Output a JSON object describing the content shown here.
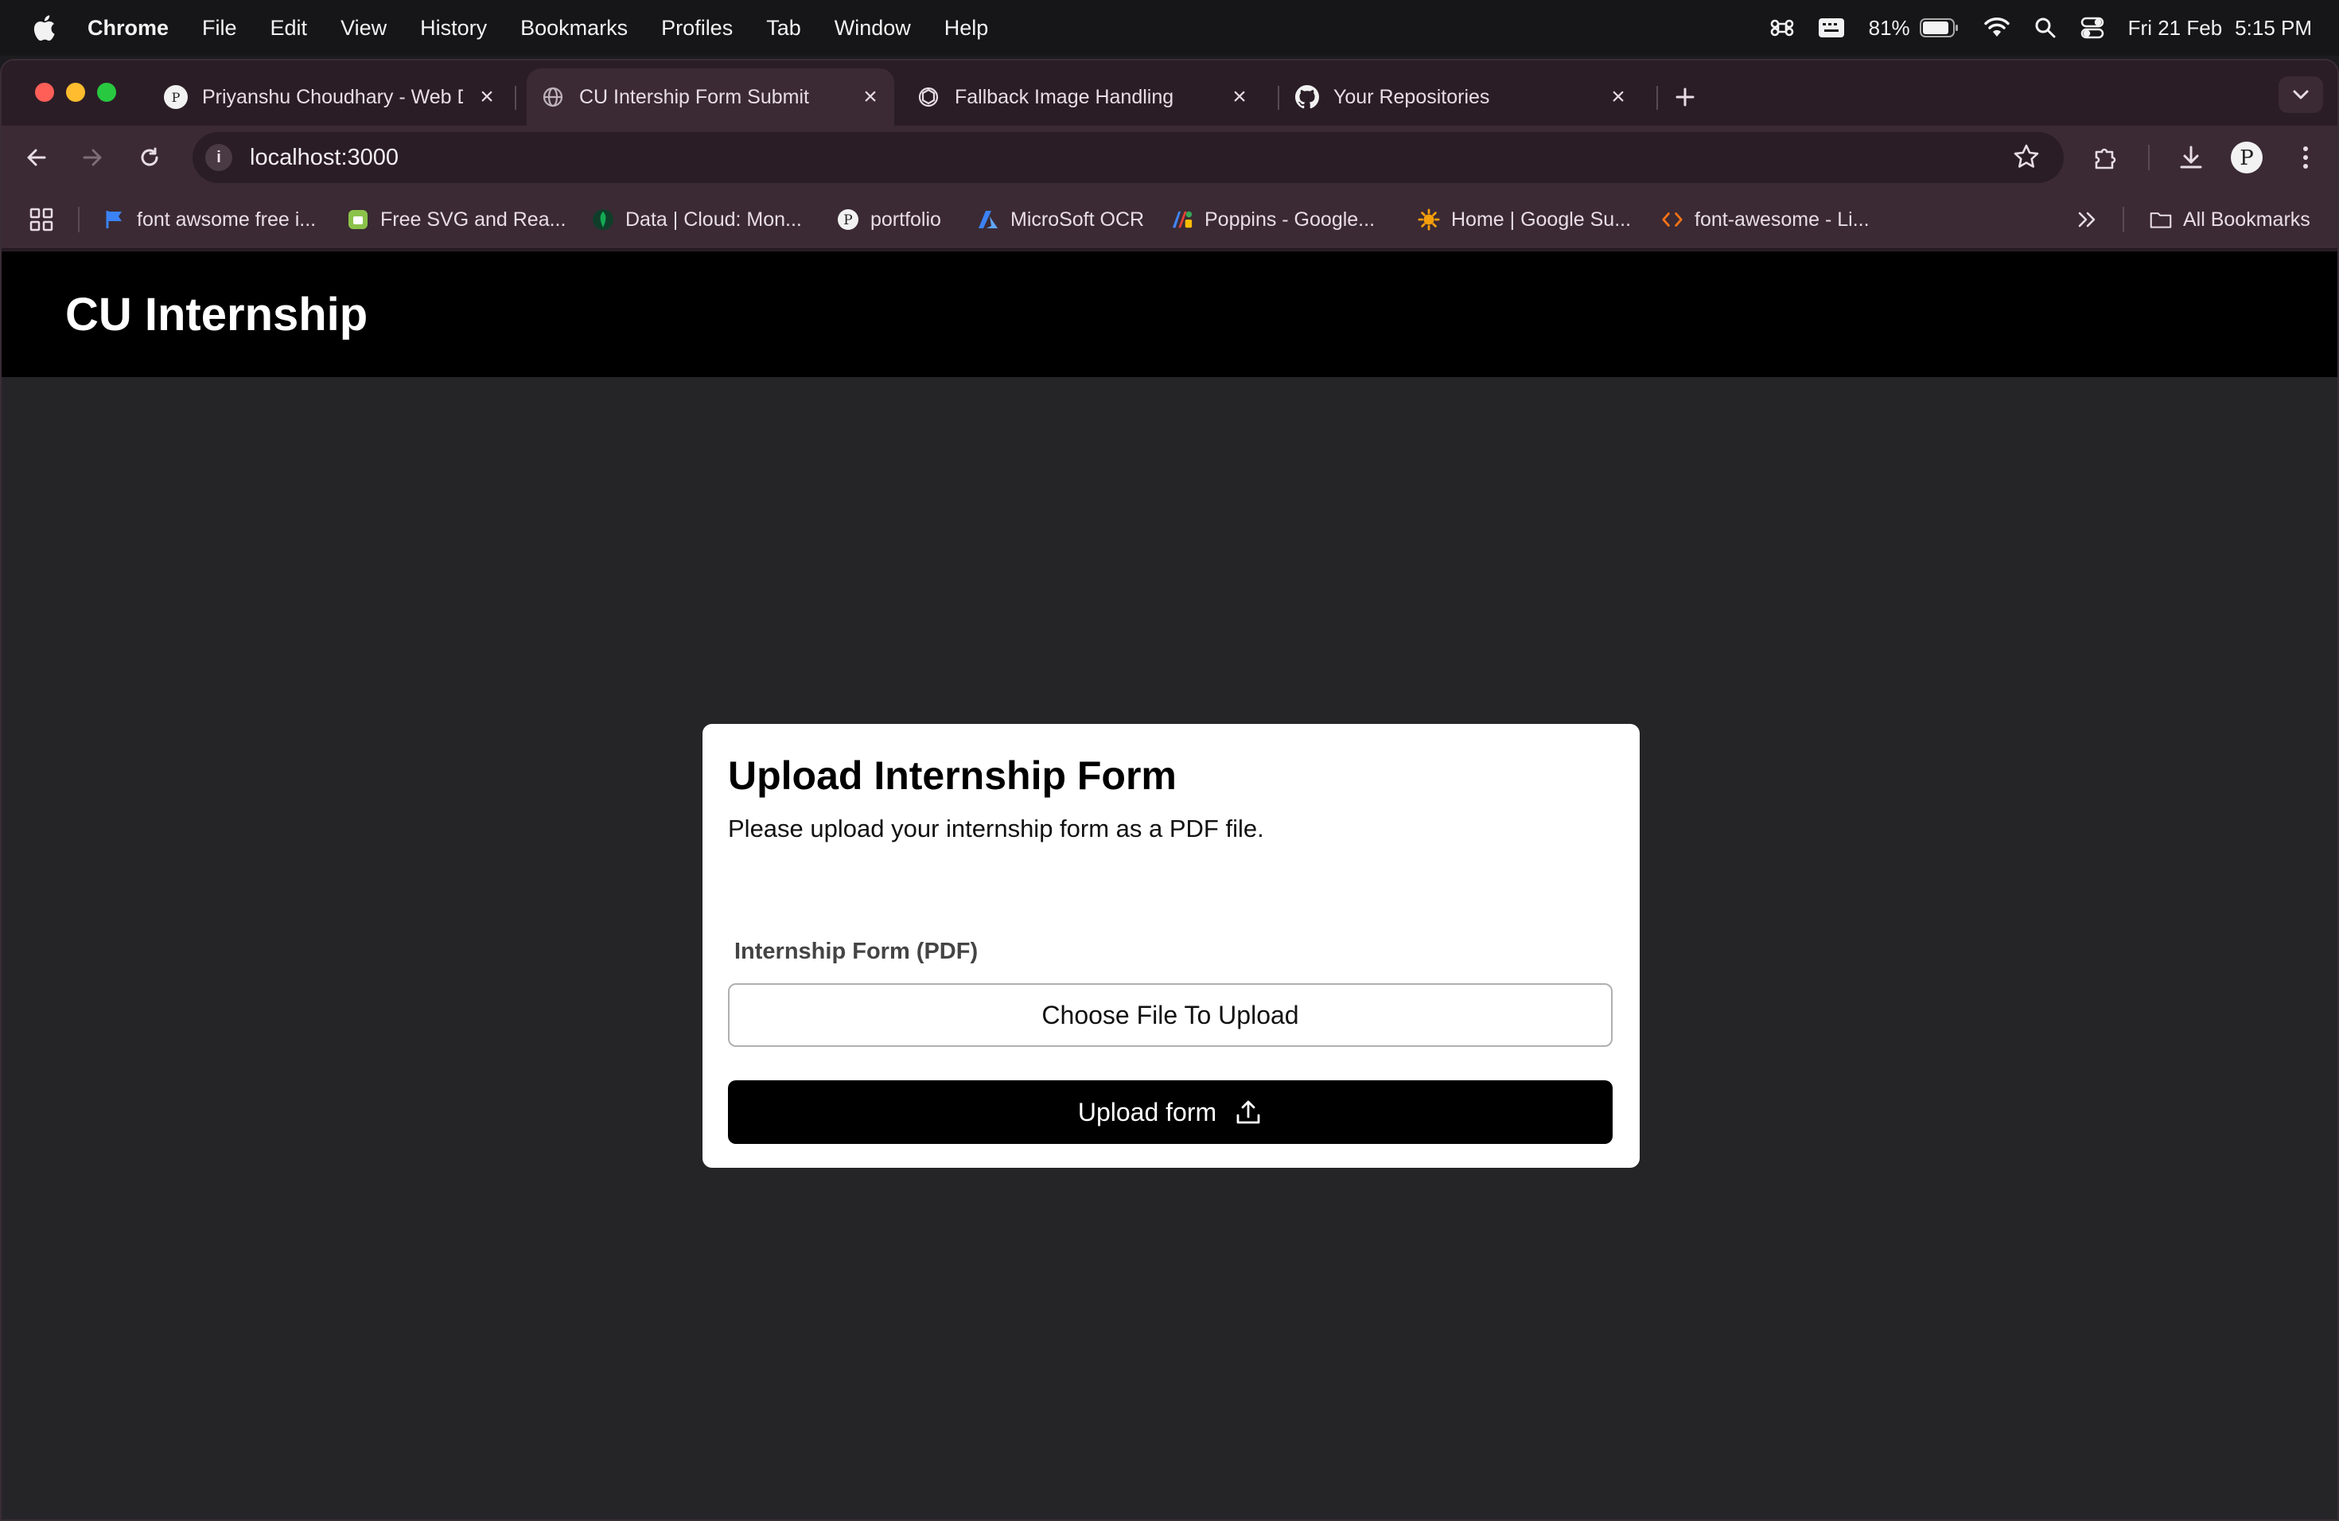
{
  "menubar": {
    "app_name": "Chrome",
    "items": [
      "File",
      "Edit",
      "View",
      "History",
      "Bookmarks",
      "Profiles",
      "Tab",
      "Window",
      "Help"
    ],
    "battery": "81%",
    "date": "Fri 21 Feb",
    "time": "5:15 PM"
  },
  "tabs": [
    {
      "title": "Priyanshu Choudhary - Web D",
      "icon": "profile-favicon"
    },
    {
      "title": "CU Intership Form Submit",
      "icon": "globe-favicon",
      "active": true
    },
    {
      "title": "Fallback Image Handling",
      "icon": "openai-favicon"
    },
    {
      "title": "Your Repositories",
      "icon": "github-favicon"
    }
  ],
  "omnibox": {
    "url": "localhost:3000"
  },
  "bookmarks": {
    "items": [
      {
        "label": "font awsome free i...",
        "icon": "flag-icon",
        "color": "#3b82f6"
      },
      {
        "label": "Free SVG and Rea...",
        "icon": "svgrepo-icon",
        "color": "#8bc34a"
      },
      {
        "label": "Data | Cloud: Mon...",
        "icon": "mongodb-leaf-icon",
        "color": "#13aa52"
      },
      {
        "label": "portfolio",
        "icon": "profile-favicon",
        "color": "#ffffff"
      },
      {
        "label": "MicroSoft OCR",
        "icon": "azure-icon",
        "color": "#3b82f6"
      },
      {
        "label": "Poppins - Google...",
        "icon": "google-fonts-icon",
        "color": "#ea4335"
      },
      {
        "label": "Home | Google Su...",
        "icon": "google-sun-icon",
        "color": "#f59e0b"
      },
      {
        "label": "font-awesome - Li...",
        "icon": "code-icon",
        "color": "#f97316"
      }
    ],
    "all_bookmarks": "All Bookmarks"
  },
  "site": {
    "header_title": "CU Internship"
  },
  "form": {
    "title": "Upload Internship Form",
    "description": "Please upload your internship form as a PDF file.",
    "field_label": "Internship Form (PDF)",
    "file_button": "Choose File To Upload",
    "submit_label": "Upload form"
  }
}
